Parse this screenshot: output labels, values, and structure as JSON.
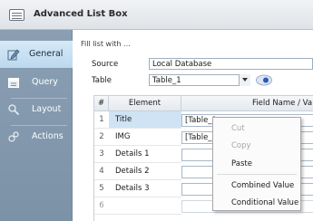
{
  "window": {
    "title": "Advanced List Box"
  },
  "sidebar": {
    "items": [
      {
        "label": "General",
        "icon": "pencil-icon",
        "active": true
      },
      {
        "label": "Query",
        "icon": "calendar-icon",
        "active": false
      },
      {
        "label": "Layout",
        "icon": "magnifier-icon",
        "active": false
      },
      {
        "label": "Actions",
        "icon": "gear-link-icon",
        "active": false
      }
    ]
  },
  "main": {
    "section_title": "Fill list with ...",
    "source": {
      "label": "Source",
      "value": "Local Database"
    },
    "table": {
      "label": "Table",
      "value": "Table_1"
    },
    "grid": {
      "columns": [
        "#",
        "Element",
        "Field Name / Va"
      ],
      "rows": [
        {
          "num": "1",
          "element": "Title",
          "field": "[Table_1",
          "selected": true
        },
        {
          "num": "2",
          "element": "IMG",
          "field": "[Table_1",
          "selected": false
        },
        {
          "num": "3",
          "element": "Details 1",
          "field": "",
          "selected": false
        },
        {
          "num": "4",
          "element": "Details 2",
          "field": "",
          "selected": false
        },
        {
          "num": "5",
          "element": "Details 3",
          "field": "",
          "selected": false
        },
        {
          "num": "6",
          "element": "",
          "field": "",
          "selected": false
        }
      ]
    }
  },
  "context_menu": {
    "items": [
      {
        "label": "Cut",
        "enabled": false
      },
      {
        "label": "Copy",
        "enabled": false
      },
      {
        "label": "Paste",
        "enabled": true
      },
      {
        "label": "Combined Value",
        "enabled": true
      },
      {
        "label": "Conditional Value",
        "enabled": true
      }
    ]
  },
  "colors": {
    "sidebar": "#8499ad",
    "active_nav": "#c8e0f2",
    "selected_row": "#cfe3f4"
  }
}
